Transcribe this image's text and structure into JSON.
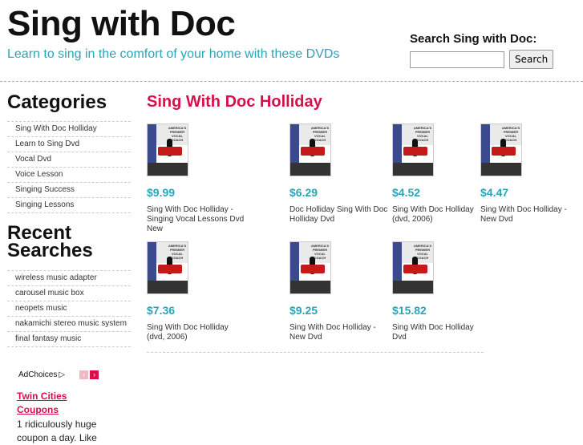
{
  "site": {
    "title": "Sing with Doc",
    "tagline": "Learn to sing in the comfort of your home with these DVDs"
  },
  "search": {
    "label": "Search Sing with Doc:",
    "button": "Search",
    "value": ""
  },
  "sidebar": {
    "categories_heading": "Categories",
    "categories": [
      "Sing With Doc Holliday",
      "Learn to Sing Dvd",
      "Vocal Dvd",
      "Voice Lesson",
      "Singing Success",
      "Singing Lessons"
    ],
    "recent_heading": "Recent Searches",
    "recent": [
      "wireless music adapter",
      "carousel music box",
      "neopets music",
      "nakamichi stereo music system",
      "final fantasy music"
    ],
    "ad": {
      "adchoices": "AdChoices",
      "link": "Twin Cities Coupons",
      "text": "1 ridiculously huge coupon a day. Like"
    }
  },
  "main": {
    "title": "Sing With Doc Holliday",
    "products": [
      {
        "price": "$9.99",
        "title": "Sing With Doc Holliday - Singing Vocal Lessons Dvd New"
      },
      {
        "price": "$6.29",
        "title": "Doc Holliday Sing With Doc Holliday Dvd"
      },
      {
        "price": "$4.52",
        "title": "Sing With Doc Holliday (dvd, 2006)"
      },
      {
        "price": "$4.47",
        "title": "Sing With Doc Holliday - New Dvd"
      },
      {
        "price": "$7.36",
        "title": "Sing With Doc Holliday (dvd, 2006)"
      },
      {
        "price": "$9.25",
        "title": "Sing With Doc Holliday - New Dvd"
      },
      {
        "price": "$15.82",
        "title": "Sing With Doc Holliday Dvd"
      }
    ],
    "cover_text": "AMERICA'S PREMIER VOCAL COACH"
  },
  "colors": {
    "accent_pink": "#d8104a",
    "accent_teal": "#2aa5b8"
  }
}
